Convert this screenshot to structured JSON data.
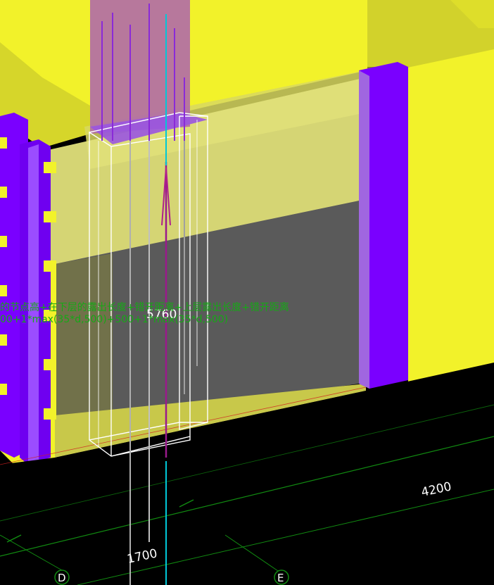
{
  "viewport": {
    "colors": {
      "background": "#000000",
      "wall": "#f2f22a",
      "wall_shade": "#c9c92a",
      "column": "#7a00ff",
      "column_upper": "#b06aa8",
      "rebar_outline": "#ffffff",
      "rebar_selected": "#9a1a8c",
      "rebar_axis": "#00c8d8",
      "grid_line": "#118a11",
      "formula_text": "#16a816"
    }
  },
  "dimensions": {
    "center_length": "5760",
    "span_length": "4200",
    "lower_length": "1700"
  },
  "formula": {
    "line1": "的节点高+在下层的露出长度+错开距离+上层露出长度+错开距离",
    "line2": "00+1*max(35*d,500)+500+1*max(35*d,500)"
  },
  "grid_axes": {
    "left": "D",
    "right": "E"
  }
}
